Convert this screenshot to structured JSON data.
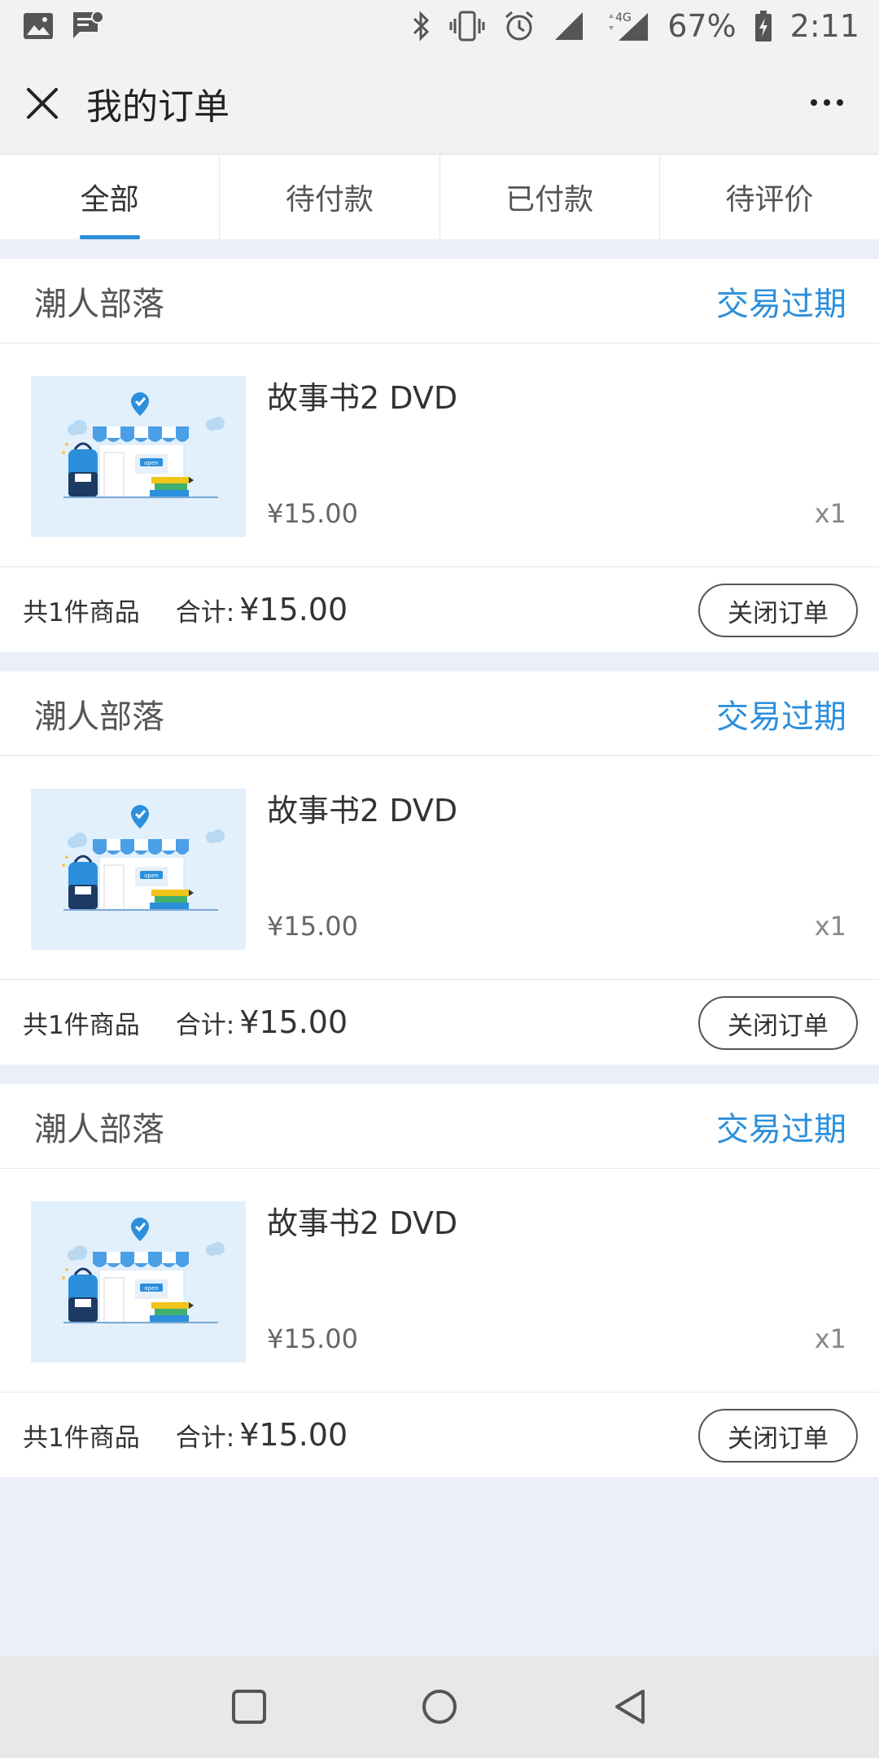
{
  "status_bar": {
    "battery": "67%",
    "time": "2:11",
    "network": "4G",
    "icons": [
      "image-icon",
      "message-icon",
      "bluetooth-icon",
      "vibrate-icon",
      "alarm-icon",
      "signal-icon",
      "battery-icon"
    ]
  },
  "header": {
    "title": "我的订单",
    "close_icon": "close-icon",
    "more_icon": "more-icon"
  },
  "tabs": [
    {
      "label": "全部",
      "active": true
    },
    {
      "label": "待付款",
      "active": false
    },
    {
      "label": "已付款",
      "active": false
    },
    {
      "label": "待评价",
      "active": false
    }
  ],
  "orders": [
    {
      "store": "潮人部落",
      "status": "交易过期",
      "item": {
        "name": "故事书2 DVD",
        "price": "¥15.00",
        "qty": "x1"
      },
      "count": "共1件商品",
      "total_label": "合计:",
      "total": "¥15.00",
      "action": "关闭订单"
    },
    {
      "store": "潮人部落",
      "status": "交易过期",
      "item": {
        "name": "故事书2 DVD",
        "price": "¥15.00",
        "qty": "x1"
      },
      "count": "共1件商品",
      "total_label": "合计:",
      "total": "¥15.00",
      "action": "关闭订单"
    },
    {
      "store": "潮人部落",
      "status": "交易过期",
      "item": {
        "name": "故事书2 DVD",
        "price": "¥15.00",
        "qty": "x1"
      },
      "count": "共1件商品",
      "total_label": "合计:",
      "total": "¥15.00",
      "action": "关闭订单"
    }
  ],
  "thumbnail_text": "open",
  "colors": {
    "accent": "#2c8fdc",
    "background": "#ebeff7",
    "thumbnail_bg": "#e2f0fc"
  },
  "nav_bar": [
    "square-icon",
    "circle-icon",
    "back-triangle-icon"
  ]
}
